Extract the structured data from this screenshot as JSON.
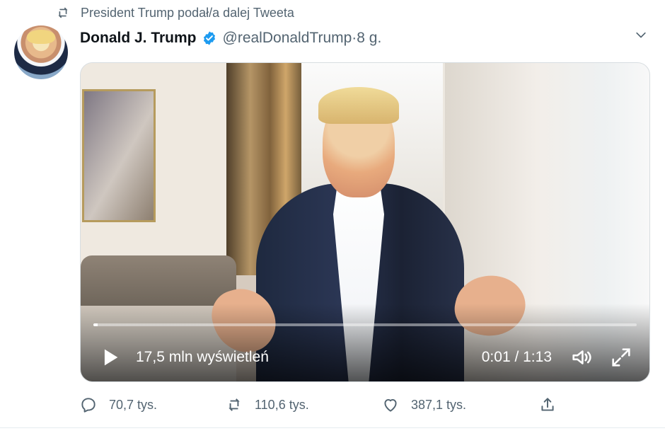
{
  "retweet_context": {
    "text": "President Trump podał/a dalej Tweeta",
    "icon": "retweet-icon"
  },
  "author": {
    "name": "Donald J. Trump",
    "handle": "@realDonaldTrump",
    "separator": " · ",
    "time": "8 g.",
    "verified_icon": "verified-badge-icon",
    "avatar_icon": "profile-photo"
  },
  "more_icon": "chevron-down-icon",
  "video": {
    "views": "17,5 mln wyświetleń",
    "time": "0:01 / 1:13",
    "progress": 0.008,
    "play_icon": "play-icon",
    "volume_icon": "volume-icon",
    "fullscreen_icon": "fullscreen-icon"
  },
  "actions": {
    "reply": "70,7 tys.",
    "retweet": "110,6 tys.",
    "like": "387,1 tys.",
    "share_icon": "share-icon"
  },
  "colors": {
    "accent": "#1d9bf0",
    "muted": "#536471",
    "text": "#0f1419"
  }
}
